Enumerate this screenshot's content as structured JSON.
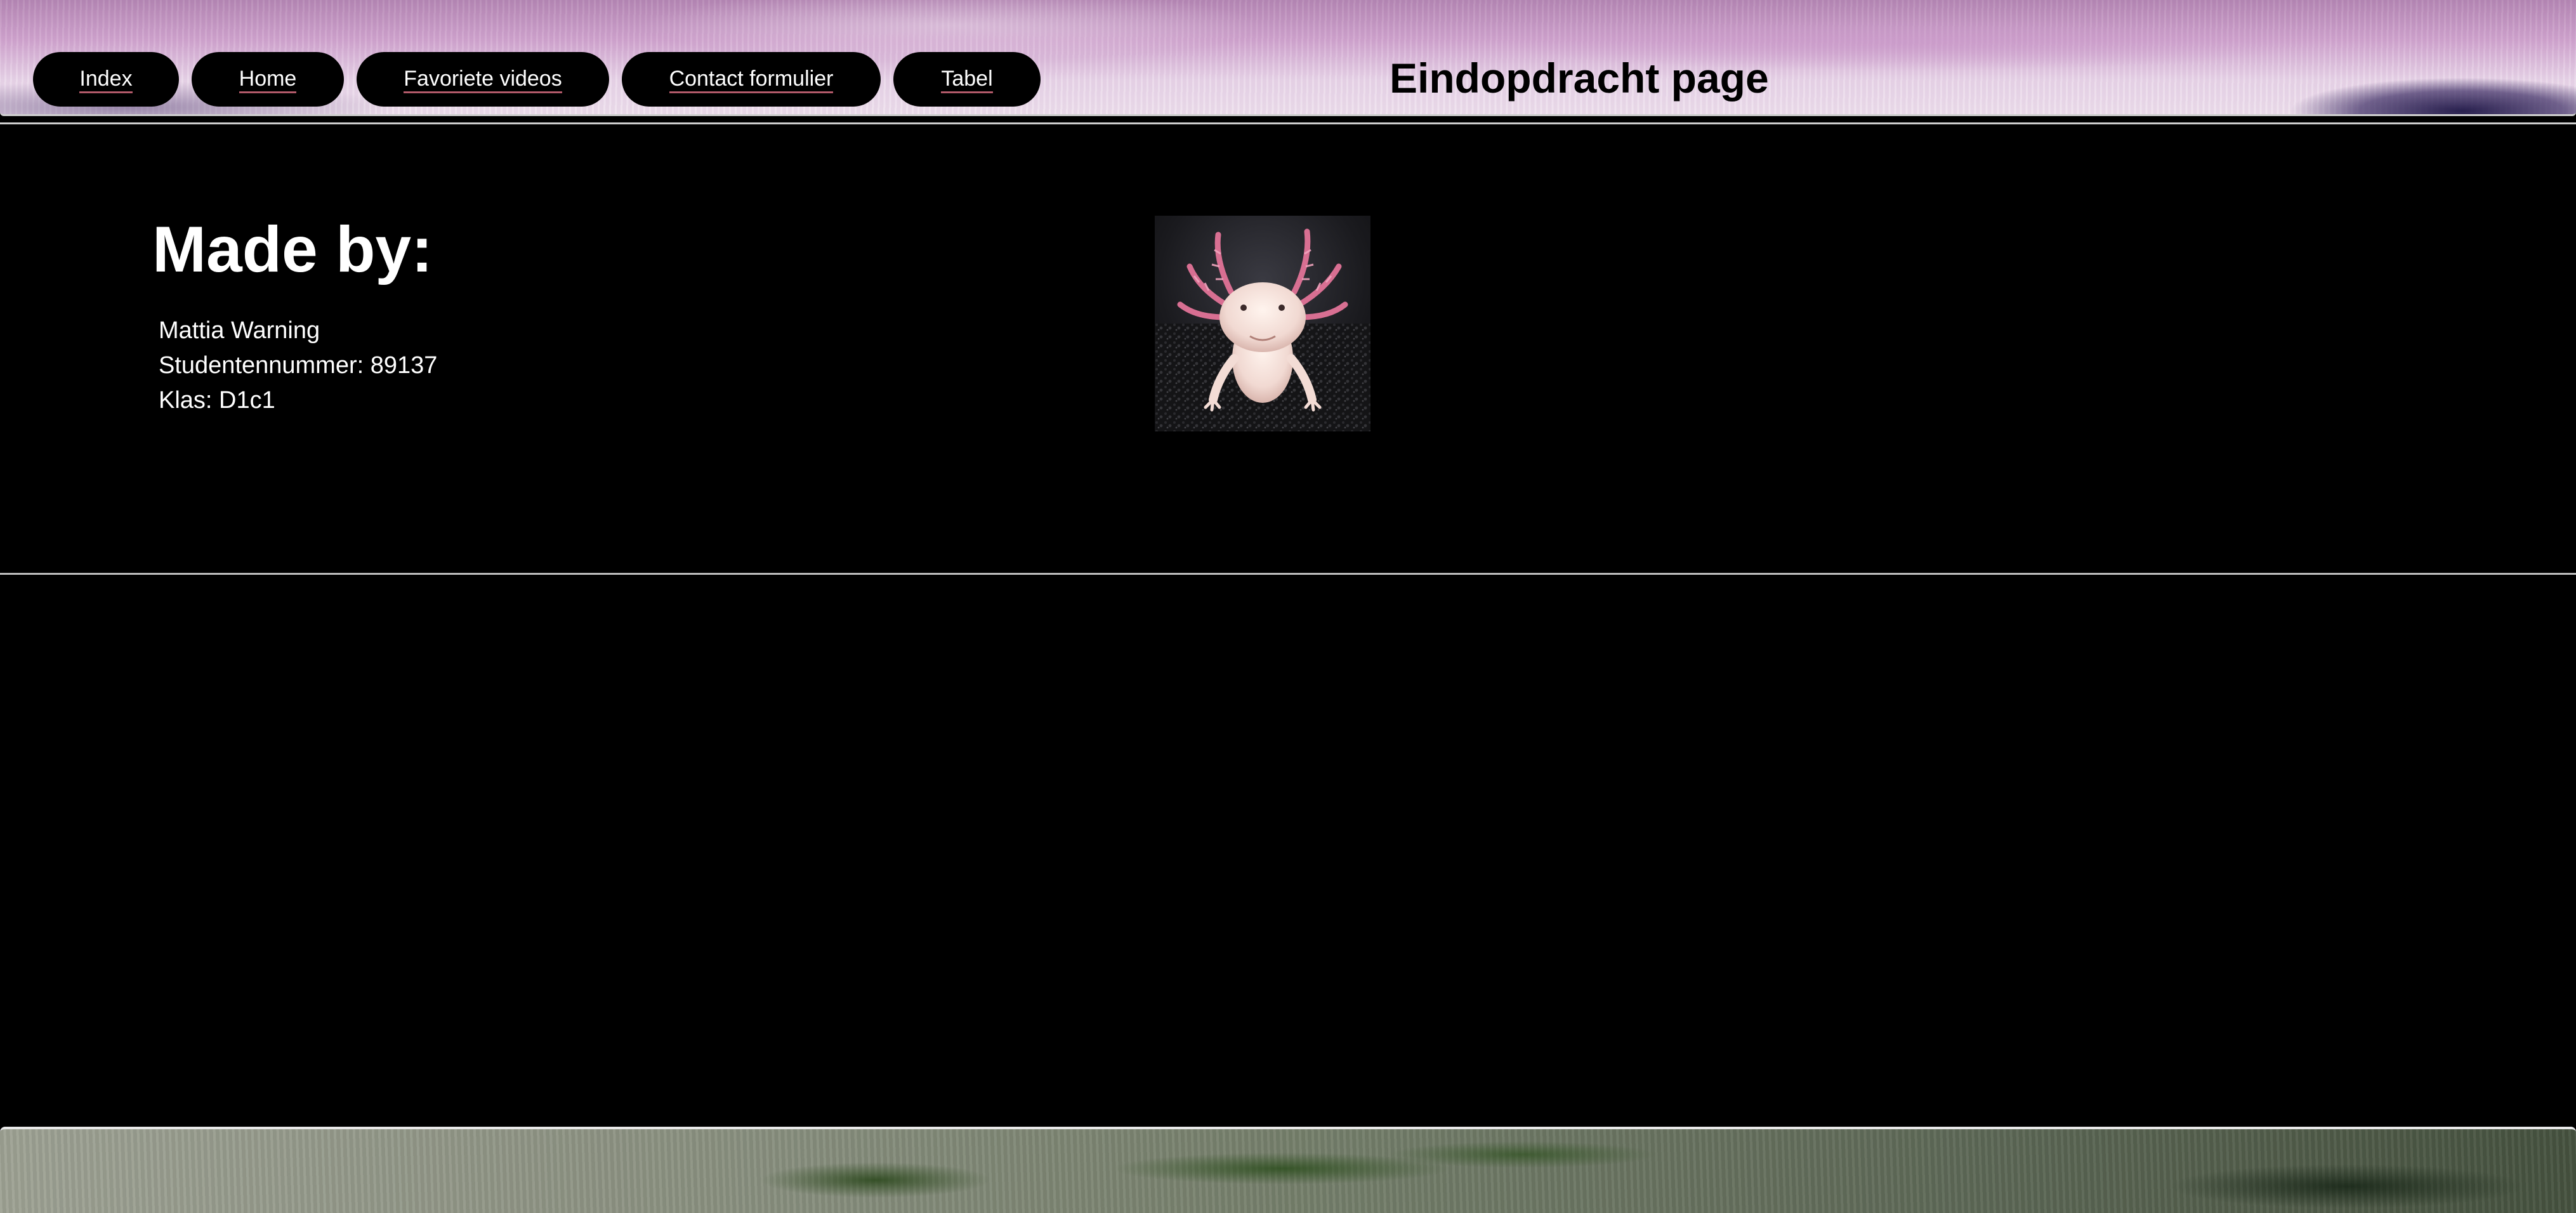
{
  "header": {
    "nav": [
      {
        "label": "Index"
      },
      {
        "label": "Home"
      },
      {
        "label": "Favoriete videos"
      },
      {
        "label": "Contact formulier"
      },
      {
        "label": "Tabel"
      }
    ],
    "title": "Eindopdracht page"
  },
  "main": {
    "heading": "Made by:",
    "name": "Mattia Warning",
    "student_number": "Studentennummer: 89137",
    "class": "Klas: D1c1"
  },
  "image": {
    "subject": "axolotl-photo"
  },
  "colors": {
    "background": "#000000",
    "nav_button": "#000000",
    "nav_text": "#ffffff",
    "link_underline": "#b35a6a",
    "title_text": "#000000"
  }
}
